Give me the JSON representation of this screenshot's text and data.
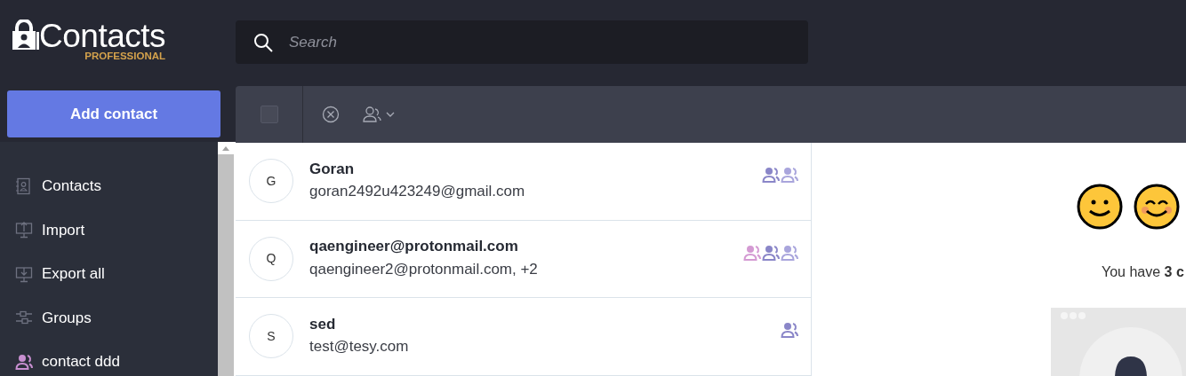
{
  "app": {
    "name": "Contacts",
    "edition": "PROFESSIONAL"
  },
  "search": {
    "placeholder": "Search"
  },
  "add_button": "Add contact",
  "sidebar": {
    "items": [
      {
        "kind": "contacts",
        "label": "Contacts"
      },
      {
        "kind": "import",
        "label": "Import"
      },
      {
        "kind": "export",
        "label": "Export all"
      },
      {
        "kind": "groups",
        "label": "Groups"
      },
      {
        "kind": "group",
        "label": "contact ddd",
        "color": "#c88fd0"
      }
    ]
  },
  "toolbar": {
    "select_all": {
      "checked": false
    }
  },
  "contacts": [
    {
      "initial": "G",
      "name": "Goran",
      "email": "goran2492u423249@gmail.com",
      "groups": [
        {
          "color": "#8a86c8"
        },
        {
          "color": "#a9a5dc"
        }
      ]
    },
    {
      "initial": "Q",
      "name": "qaengineer@protonmail.com",
      "email": "qaengineer2@protonmail.com, +2",
      "groups": [
        {
          "color": "#d49ad3"
        },
        {
          "color": "#8a86c8"
        },
        {
          "color": "#a9a5dc"
        }
      ]
    },
    {
      "initial": "S",
      "name": "sed",
      "email": "test@tesy.com",
      "groups": [
        {
          "color": "#8a86c8"
        }
      ]
    }
  ],
  "details": {
    "summary": "You have **3 c**"
  }
}
